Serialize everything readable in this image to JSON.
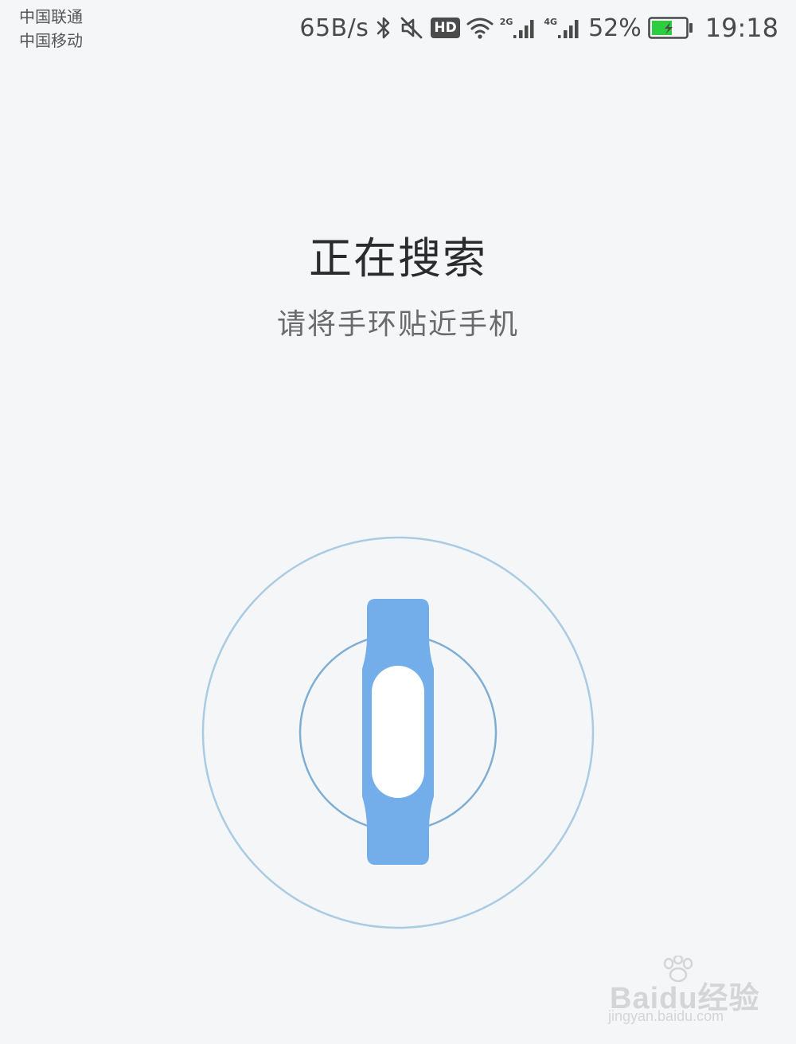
{
  "status_bar": {
    "carriers": [
      "中国联通",
      "中国移动"
    ],
    "net_speed": "65B/s",
    "icons": [
      "bluetooth-icon",
      "mute-icon",
      "hd-icon",
      "wifi-icon",
      "signal-2g-icon",
      "signal-4g-icon",
      "battery-charging-icon"
    ],
    "hd_label": "HD",
    "signal_1_tag": "2G",
    "signal_2_tag": "4G",
    "battery_percent": "52%",
    "time": "19:18",
    "battery_color": "#2ecc40"
  },
  "main": {
    "title": "正在搜索",
    "subtitle": "请将手环贴近手机",
    "band_color": "#73aeea",
    "ring_color": "#a9cbe3"
  },
  "watermark": {
    "brand": "Baidu经验",
    "url": "jingyan.baidu.com"
  }
}
